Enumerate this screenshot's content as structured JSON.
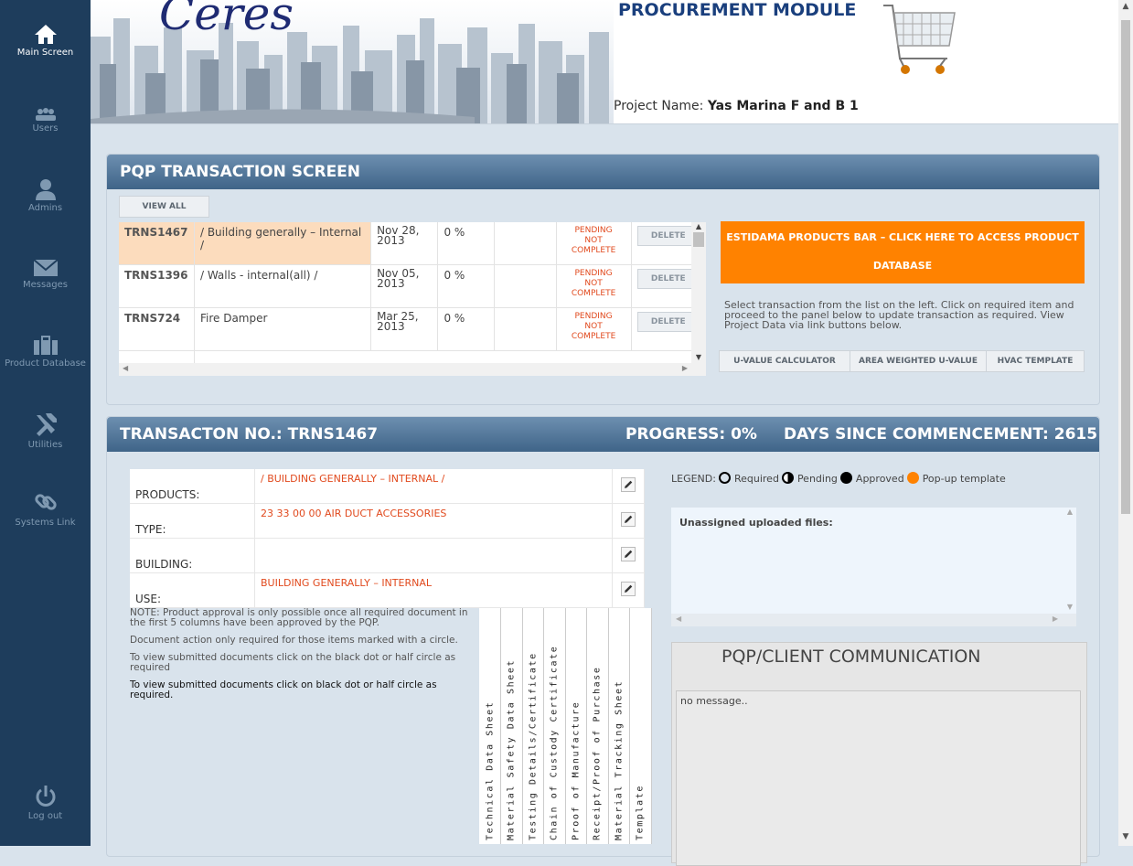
{
  "sidebar": {
    "items": [
      {
        "label": "Main Screen",
        "icon": "home-icon",
        "active": true
      },
      {
        "label": "Users",
        "icon": "users-icon"
      },
      {
        "label": "Admins",
        "icon": "admin-icon"
      },
      {
        "label": "Messages",
        "icon": "envelope-icon"
      },
      {
        "label": "Product Database",
        "icon": "briefcase-icon"
      },
      {
        "label": "Utilities",
        "icon": "tools-icon"
      },
      {
        "label": "Systems Link",
        "icon": "link-icon"
      }
    ],
    "logout": "Log out"
  },
  "header": {
    "logo": "Ceres",
    "module": "PROCUREMENT MODULE",
    "project_label": "Project Name:",
    "project_name": "Yas Marina F and B 1"
  },
  "pqp": {
    "title": "PQP TRANSACTION SCREEN",
    "view_all": "VIEW ALL",
    "rows": [
      {
        "id": "TRNS1467",
        "desc": "/ Building generally – Internal /",
        "date": "Nov 28, 2013",
        "progress": "0 %",
        "status1": "PENDING",
        "status2": "NOT",
        "status3": "COMPLETE",
        "delete": "DELETE",
        "selected": true
      },
      {
        "id": "TRNS1396",
        "desc": "/ Walls - internal(all) /",
        "date": "Nov 05, 2013",
        "progress": "0 %",
        "status1": "PENDING",
        "status2": "NOT",
        "status3": "COMPLETE",
        "delete": "DELETE"
      },
      {
        "id": "TRNS724",
        "desc": "Fire Damper",
        "date": "Mar 25, 2013",
        "progress": "0 %",
        "status1": "PENDING",
        "status2": "NOT",
        "status3": "COMPLETE",
        "delete": "DELETE"
      }
    ],
    "estidama_bar": "ESTIDAMA PRODUCTS BAR – CLICK HERE TO ACCESS PRODUCT DATABASE",
    "instructions": "Select transaction from the list on the left. Click on required item and proceed to the panel below to update transaction as required. View Project Data via link buttons below.",
    "links": [
      "U-VALUE CALCULATOR",
      "AREA WEIGHTED U-VALUE",
      "HVAC TEMPLATE"
    ]
  },
  "transaction": {
    "title": "TRANSACTON NO.: TRNS1467",
    "progress": "PROGRESS: 0%",
    "days": "DAYS SINCE COMMENCEMENT: 2615",
    "fields": [
      {
        "label": "PRODUCTS:",
        "value": "/ BUILDING GENERALLY – INTERNAL /"
      },
      {
        "label": "TYPE:",
        "value": "23 33 00 00 AIR DUCT ACCESSORIES"
      },
      {
        "label": "BUILDING:",
        "value": ""
      },
      {
        "label": "USE:",
        "value": "BUILDING GENERALLY – INTERNAL"
      }
    ],
    "notes": [
      "NOTE: Product approval is only possible once all required document in the first 5 columns have been approved by the PQP.",
      "Document action only required for those items marked with a circle.",
      "To view submitted documents click on the black dot or half circle as required",
      "To view submitted documents click on black dot or half circle as required."
    ],
    "columns": [
      "Technical Data Sheet",
      "Material Safety Data Sheet",
      "Testing Details/Certificate",
      "Chain of Custody Certificate",
      "Proof of Manufacture",
      "Receipt/Proof of Purchase",
      "Material Tracking Sheet",
      "Template"
    ],
    "legend": {
      "label": "LEGEND:",
      "required": "Required",
      "pending": "Pending",
      "approved": "Approved",
      "popup": "Pop-up template"
    },
    "unassigned": "Unassigned uploaded files:",
    "comm_title": "PQP/CLIENT COMMUNICATION",
    "comm_message": "no message.."
  },
  "colors": {
    "sidebar": "#1e3d5c",
    "orange": "#ff8200",
    "status_red": "#e14a1e",
    "header_blue": "#1a3f7d"
  }
}
